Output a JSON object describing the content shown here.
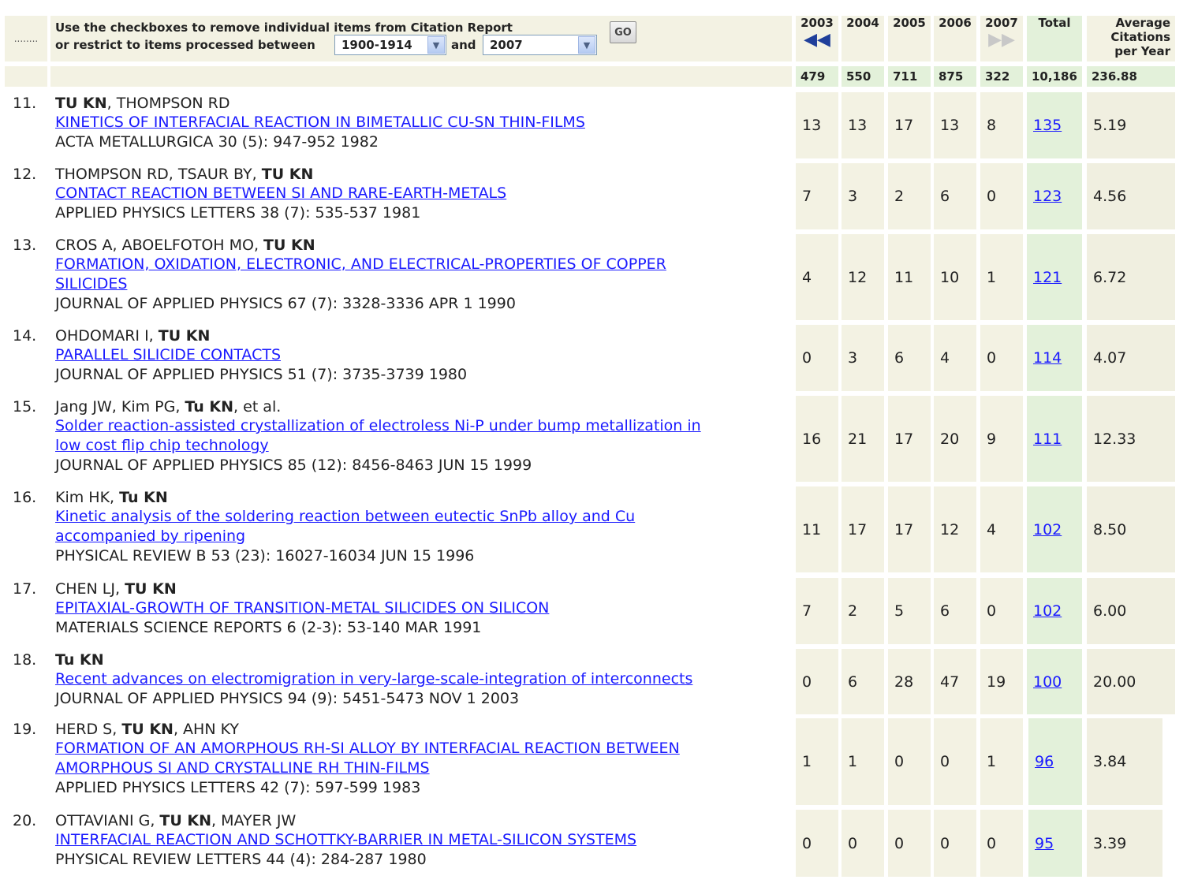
{
  "filter": {
    "line1": "Use the checkboxes to remove individual items from Citation Report",
    "line2": "or restrict to items processed between",
    "from_value": "1900-1914",
    "and_label": "and",
    "to_value": "2007",
    "go_label": "GO",
    "dots": "........"
  },
  "columns": {
    "years": [
      "2003",
      "2004",
      "2005",
      "2006",
      "2007"
    ],
    "total": "Total",
    "average": [
      "Average",
      "Citations",
      "per Year"
    ]
  },
  "sums": [
    "479",
    "550",
    "711",
    "875",
    "322",
    "10,186",
    "236.88"
  ],
  "rows": [
    {
      "num": "11.",
      "authors": [
        {
          "t": "TU KN",
          "b": true
        },
        {
          "t": ", THOMPSON RD",
          "b": false
        }
      ],
      "title": [
        "KINETICS OF INTERFACIAL REACTION IN BIMETALLIC CU-SN THIN-FILMS"
      ],
      "source": "ACTA METALLURGICA 30 (5): 947-952 1982",
      "y": [
        "13",
        "13",
        "17",
        "13",
        "8"
      ],
      "total": "135",
      "avg": "5.19"
    },
    {
      "num": "12.",
      "authors": [
        {
          "t": "THOMPSON RD, TSAUR BY, ",
          "b": false
        },
        {
          "t": "TU KN",
          "b": true
        }
      ],
      "title": [
        "CONTACT REACTION BETWEEN SI AND RARE-EARTH-METALS"
      ],
      "source": "APPLIED PHYSICS LETTERS 38 (7): 535-537 1981",
      "y": [
        "7",
        "3",
        "2",
        "6",
        "0"
      ],
      "total": "123",
      "avg": "4.56"
    },
    {
      "num": "13.",
      "authors": [
        {
          "t": "CROS A, ABOELFOTOH MO, ",
          "b": false
        },
        {
          "t": "TU KN",
          "b": true
        }
      ],
      "title": [
        "FORMATION, OXIDATION, ELECTRONIC, AND ELECTRICAL-PROPERTIES OF COPPER",
        "SILICIDES"
      ],
      "source": "JOURNAL OF APPLIED PHYSICS 67 (7): 3328-3336 APR 1 1990",
      "y": [
        "4",
        "12",
        "11",
        "10",
        "1"
      ],
      "total": "121",
      "avg": "6.72"
    },
    {
      "num": "14.",
      "authors": [
        {
          "t": "OHDOMARI I, ",
          "b": false
        },
        {
          "t": "TU KN",
          "b": true
        }
      ],
      "title": [
        "PARALLEL SILICIDE CONTACTS"
      ],
      "source": "JOURNAL OF APPLIED PHYSICS 51 (7): 3735-3739 1980",
      "y": [
        "0",
        "3",
        "6",
        "4",
        "0"
      ],
      "total": "114",
      "avg": "4.07"
    },
    {
      "num": "15.",
      "authors": [
        {
          "t": "Jang JW, Kim PG, ",
          "b": false
        },
        {
          "t": "Tu KN",
          "b": true
        },
        {
          "t": ", et al.",
          "b": false
        }
      ],
      "title": [
        "Solder reaction-assisted crystallization of electroless Ni-P under bump metallization in",
        "low cost flip chip technology"
      ],
      "source": "JOURNAL OF APPLIED PHYSICS 85 (12): 8456-8463 JUN 15 1999",
      "y": [
        "16",
        "21",
        "17",
        "20",
        "9"
      ],
      "total": "111",
      "avg": "12.33"
    },
    {
      "num": "16.",
      "authors": [
        {
          "t": "Kim HK, ",
          "b": false
        },
        {
          "t": "Tu KN",
          "b": true
        }
      ],
      "title": [
        "Kinetic analysis of the soldering reaction between eutectic SnPb alloy and Cu",
        "accompanied by ripening"
      ],
      "source": "PHYSICAL REVIEW B 53 (23): 16027-16034 JUN 15 1996",
      "y": [
        "11",
        "17",
        "17",
        "12",
        "4"
      ],
      "total": "102",
      "avg": "8.50"
    },
    {
      "num": "17.",
      "authors": [
        {
          "t": "CHEN LJ, ",
          "b": false
        },
        {
          "t": "TU KN",
          "b": true
        }
      ],
      "title": [
        "EPITAXIAL-GROWTH OF TRANSITION-METAL SILICIDES ON SILICON"
      ],
      "source": "MATERIALS SCIENCE REPORTS 6 (2-3): 53-140 MAR 1991",
      "y": [
        "7",
        "2",
        "5",
        "6",
        "0"
      ],
      "total": "102",
      "avg": "6.00"
    },
    {
      "num": "18.",
      "authors": [
        {
          "t": "Tu KN",
          "b": true
        }
      ],
      "title": [
        "Recent advances on electromigration in very-large-scale-integration of interconnects"
      ],
      "source": "JOURNAL OF APPLIED PHYSICS 94 (9): 5451-5473 NOV 1 2003",
      "y": [
        "0",
        "6",
        "28",
        "47",
        "19"
      ],
      "total": "100",
      "avg": "20.00"
    },
    {
      "num": "19.",
      "authors": [
        {
          "t": "HERD S, ",
          "b": false
        },
        {
          "t": "TU KN",
          "b": true
        },
        {
          "t": ", AHN KY",
          "b": false
        }
      ],
      "title": [
        "FORMATION OF AN AMORPHOUS RH-SI ALLOY BY INTERFACIAL REACTION BETWEEN",
        "AMORPHOUS SI AND CRYSTALLINE RH THIN-FILMS"
      ],
      "source": "APPLIED PHYSICS LETTERS 42 (7): 597-599 1983",
      "y": [
        "1",
        "1",
        "0",
        "0",
        "1"
      ],
      "total": "96",
      "avg": "3.84"
    },
    {
      "num": "20.",
      "authors": [
        {
          "t": "OTTAVIANI G, ",
          "b": false
        },
        {
          "t": "TU KN",
          "b": true
        },
        {
          "t": ", MAYER JW",
          "b": false
        }
      ],
      "title": [
        "INTERFACIAL REACTION AND SCHOTTKY-BARRIER IN METAL-SILICON SYSTEMS"
      ],
      "source": "PHYSICAL REVIEW LETTERS 44 (4): 284-287 1980",
      "y": [
        "0",
        "0",
        "0",
        "0",
        "0"
      ],
      "total": "95",
      "avg": "3.39"
    }
  ]
}
